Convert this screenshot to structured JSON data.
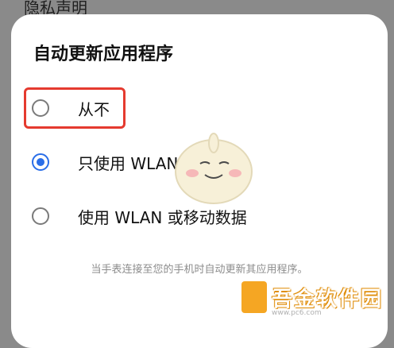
{
  "background": {
    "partial_heading": "隐私声明"
  },
  "dialog": {
    "title": "自动更新应用程序",
    "options": [
      {
        "label": "从不",
        "selected": false
      },
      {
        "label": "只使用 WLAN",
        "selected": true
      },
      {
        "label": "使用 WLAN 或移动数据",
        "selected": false
      }
    ],
    "footnote": "当手表连接至您的手机时自动更新其应用程序。"
  },
  "colors": {
    "accent": "#2a6ee8",
    "highlight": "#e53a2f",
    "watermark": "#f5a623"
  },
  "watermark": {
    "text": "吾金软件园",
    "sub": "www.pc6.com"
  }
}
